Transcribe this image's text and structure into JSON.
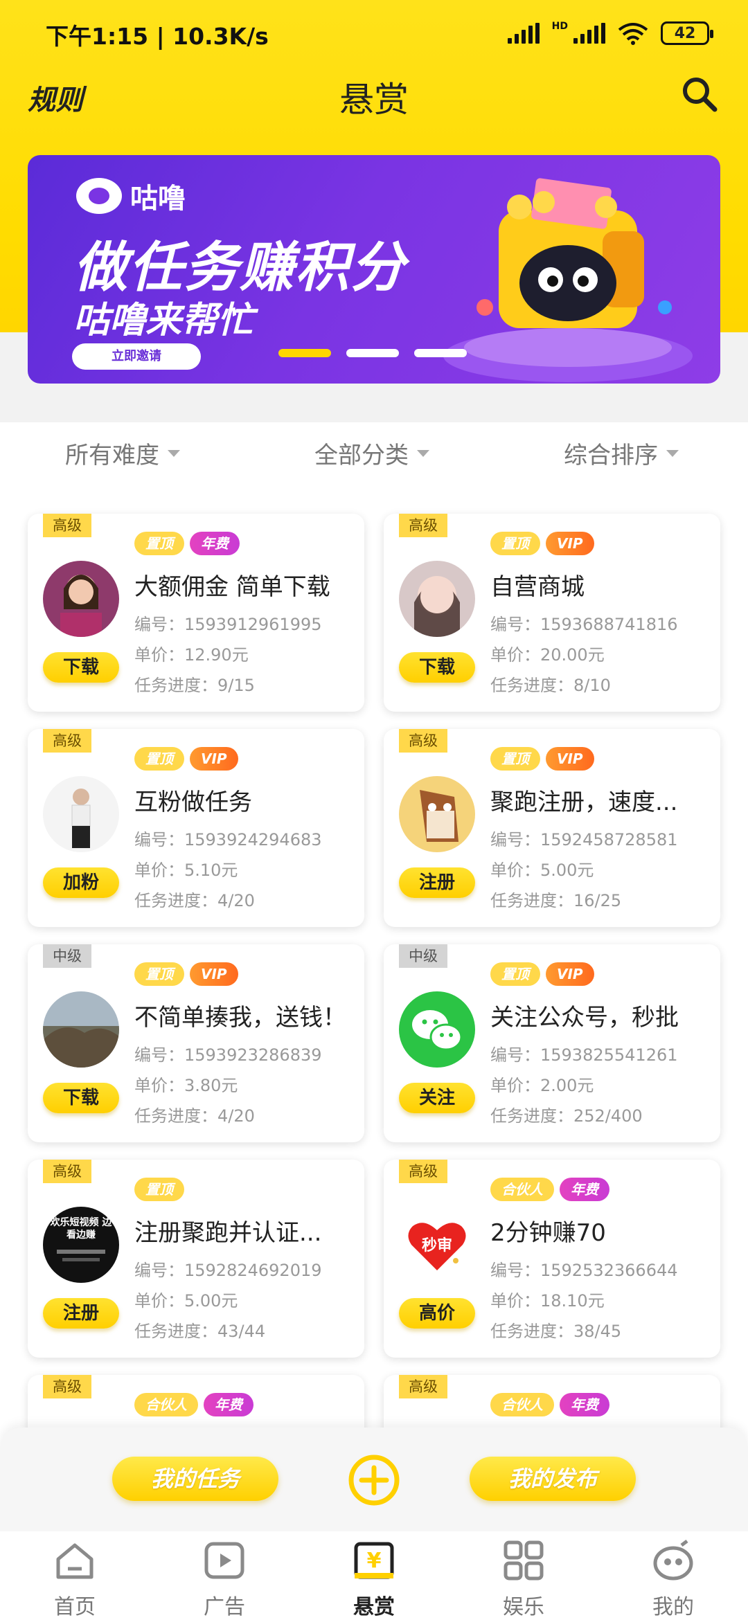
{
  "status_bar": {
    "time": "下午1:15 | 10.3K/s",
    "battery": "42",
    "hd": "HD"
  },
  "header": {
    "rules": "规则",
    "title": "悬赏"
  },
  "banner": {
    "logo": "咕噜",
    "headline": "做任务赚积分",
    "subline": "咕噜来帮忙",
    "button": "立即邀请",
    "slides": 3,
    "active_slide": 1
  },
  "filters": [
    {
      "label": "所有难度"
    },
    {
      "label": "全部分类"
    },
    {
      "label": "综合排序"
    }
  ],
  "tag_labels": {
    "top": "置顶",
    "year": "年费",
    "vip": "VIP",
    "partner": "合伙人"
  },
  "tasks": [
    {
      "level": "高级",
      "tags": [
        "置顶",
        "年费"
      ],
      "title": "大额佣金 简单下载",
      "id": "编号：1593912961995",
      "price": "单价：12.90元",
      "progress": "任务进度：9/15",
      "action": "下载",
      "avatar": "woman-portrait"
    },
    {
      "level": "高级",
      "tags": [
        "置顶",
        "VIP"
      ],
      "title": "自营商城",
      "id": "编号：1593688741816",
      "price": "单价：20.00元",
      "progress": "任务进度：8/10",
      "action": "下载",
      "avatar": "girl-portrait"
    },
    {
      "level": "高级",
      "tags": [
        "置顶",
        "VIP"
      ],
      "title": "互粉做任务",
      "id": "编号：1593924294683",
      "price": "单价：5.10元",
      "progress": "任务进度：4/20",
      "action": "加粉",
      "avatar": "fashion-photo"
    },
    {
      "level": "高级",
      "tags": [
        "置顶",
        "VIP"
      ],
      "title": "聚跑注册，速度...",
      "id": "编号：1592458728581",
      "price": "单价：5.00元",
      "progress": "任务进度：16/25",
      "action": "注册",
      "avatar": "horse-cartoon"
    },
    {
      "level": "中级",
      "tags": [
        "置顶",
        "VIP"
      ],
      "title": "不简单揍我，送钱！",
      "id": "编号：1593923286839",
      "price": "单价：3.80元",
      "progress": "任务进度：4/20",
      "action": "下载",
      "avatar": "landscape-photo"
    },
    {
      "level": "中级",
      "tags": [
        "置顶",
        "VIP"
      ],
      "title": "关注公众号，秒批",
      "id": "编号：1593825541261",
      "price": "单价：2.00元",
      "progress": "任务进度：252/400",
      "action": "关注",
      "avatar": "wechat-logo"
    },
    {
      "level": "高级",
      "tags": [
        "置顶"
      ],
      "title": "注册聚跑并认证...",
      "id": "编号：1592824692019",
      "price": "单价：5.00元",
      "progress": "任务进度：43/44",
      "action": "注册",
      "avatar": "video-app-logo",
      "avatar_text": "欢乐短视频 边看边赚"
    },
    {
      "level": "高级",
      "tags": [
        "合伙人",
        "年费"
      ],
      "title": "2分钟赚70",
      "id": "编号：1592532366644",
      "price": "单价：18.10元",
      "progress": "任务进度：38/45",
      "action": "高价",
      "avatar": "heart-logo",
      "avatar_text": "秒审"
    },
    {
      "level": "高级",
      "tags": [
        "合伙人",
        "年费"
      ],
      "title": "",
      "id": "",
      "price": "",
      "progress": "",
      "action": "",
      "avatar": ""
    },
    {
      "level": "高级",
      "tags": [
        "合伙人",
        "年费"
      ],
      "title": "",
      "id": "",
      "price": "",
      "progress": "",
      "action": "",
      "avatar": ""
    }
  ],
  "action_bar": {
    "my_tasks": "我的任务",
    "my_posts": "我的发布"
  },
  "tabs": [
    {
      "label": "首页",
      "icon": "home-icon"
    },
    {
      "label": "广告",
      "icon": "play-icon"
    },
    {
      "label": "悬赏",
      "icon": "reward-icon",
      "active": true
    },
    {
      "label": "娱乐",
      "icon": "apps-icon"
    },
    {
      "label": "我的",
      "icon": "profile-icon"
    }
  ],
  "colors": {
    "accent": "#ffd600",
    "banner": "#7a34e3",
    "year_tag": "#d63fcb",
    "vip_tag": "#ff7a22"
  }
}
